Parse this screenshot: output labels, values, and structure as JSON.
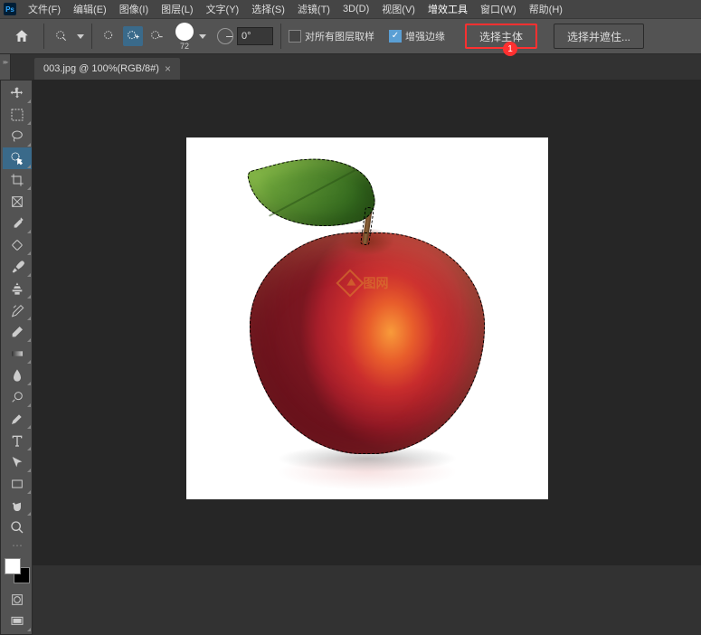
{
  "app": {
    "logo": "Ps"
  },
  "menu": {
    "file": "文件(F)",
    "edit": "编辑(E)",
    "image": "图像(I)",
    "layer": "图层(L)",
    "type": "文字(Y)",
    "select": "选择(S)",
    "filter": "滤镜(T)",
    "threed": "3D(D)",
    "view": "视图(V)",
    "plugins": "增效工具",
    "window": "窗口(W)",
    "help": "帮助(H)"
  },
  "options": {
    "brush_size": "72",
    "angle": "0°",
    "sample_all_layers": "对所有图层取样",
    "enhance_edge": "增强边缘",
    "select_subject": "选择主体",
    "select_and_mask": "选择并遮住..."
  },
  "callout": {
    "number": "1"
  },
  "tab": {
    "title": "003.jpg @ 100%(RGB/8#)"
  },
  "watermark": {
    "text": "图网"
  },
  "colors": {
    "highlight_border": "#ff3030",
    "callout_bg": "#ff3030"
  }
}
